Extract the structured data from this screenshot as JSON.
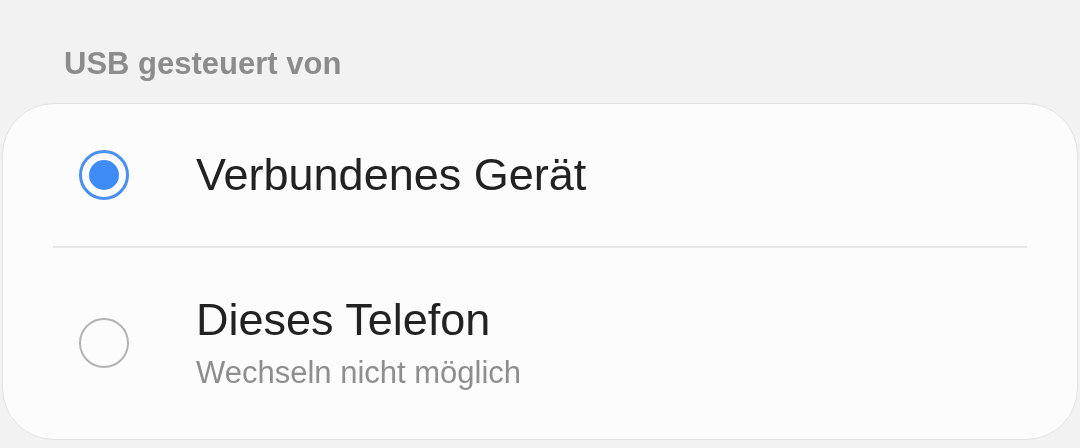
{
  "section": {
    "title": "USB gesteuert von"
  },
  "options": [
    {
      "label": "Verbundenes Gerät",
      "selected": true
    },
    {
      "label": "Dieses Telefon",
      "subtitle": "Wechseln nicht möglich",
      "selected": false
    }
  ]
}
